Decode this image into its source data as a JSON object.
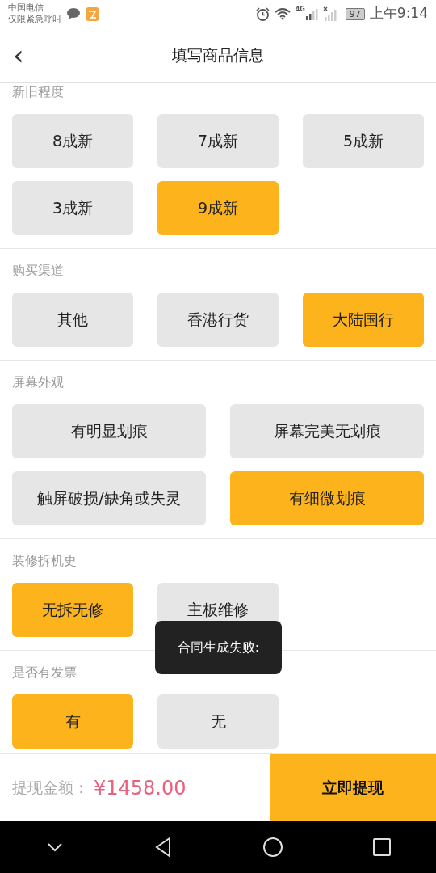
{
  "status_bar": {
    "carrier": "中国电信",
    "carrier_note": "仅限紧急呼叫",
    "network": "4G",
    "battery": "97",
    "time": "上午9:14"
  },
  "header": {
    "back": "‹",
    "title": "填写商品信息"
  },
  "sections": [
    {
      "label": "新旧程度",
      "kind": "three-column",
      "options": [
        {
          "label": "8成新",
          "selected": false
        },
        {
          "label": "7成新",
          "selected": false
        },
        {
          "label": "5成新",
          "selected": false
        },
        {
          "label": "3成新",
          "selected": false
        },
        {
          "label": "9成新",
          "selected": true
        }
      ]
    },
    {
      "label": "购买渠道",
      "kind": "three-column",
      "options": [
        {
          "label": "其他",
          "selected": false
        },
        {
          "label": "香港行货",
          "selected": false
        },
        {
          "label": "大陆国行",
          "selected": true
        }
      ]
    },
    {
      "label": "屏幕外观",
      "kind": "two-column",
      "options": [
        {
          "label": "有明显划痕",
          "selected": false
        },
        {
          "label": "屏幕完美无划痕",
          "selected": false
        },
        {
          "label": "触屏破损/缺角或失灵",
          "selected": false
        },
        {
          "label": "有细微划痕",
          "selected": true
        }
      ]
    },
    {
      "label": "装修拆机史",
      "kind": "three-column",
      "options": [
        {
          "label": "无拆无修",
          "selected": true
        },
        {
          "label": "主板维修",
          "selected": false
        }
      ]
    },
    {
      "label": "是否有发票",
      "kind": "three-column",
      "options": [
        {
          "label": "有",
          "selected": true
        },
        {
          "label": "无",
          "selected": false
        }
      ]
    }
  ],
  "toast": "合同生成失败:",
  "footer": {
    "amount_label": "提现金额：",
    "amount": "¥1458.00",
    "submit": "立即提现"
  }
}
